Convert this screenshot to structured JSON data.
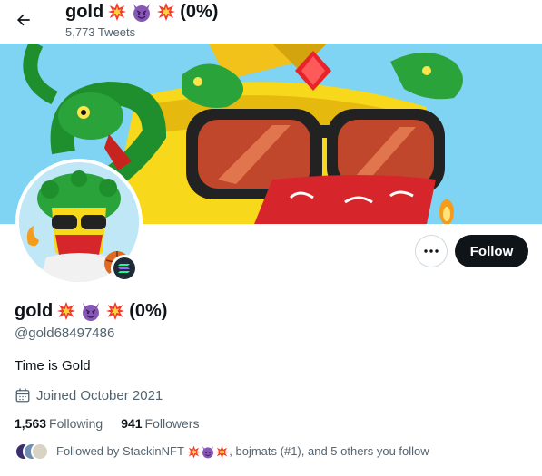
{
  "header": {
    "title_name": "gold",
    "title_suffix": "(0%)",
    "tweet_count": "5,773 Tweets"
  },
  "profile": {
    "name": "gold",
    "name_suffix": "(0%)",
    "handle": "@gold68497486",
    "bio": "Time is Gold",
    "joined": "Joined October 2021",
    "following_count": "1,563",
    "following_label": "Following",
    "followers_count": "941",
    "followers_label": "Followers"
  },
  "actions": {
    "follow_label": "Follow"
  },
  "followed_by": {
    "prefix": "Followed by StackinNFT",
    "suffix": ", bojmats (#1), and 5 others you follow"
  },
  "icons": [
    "back-arrow-icon",
    "collision-emoji-icon",
    "smiling-devil-emoji-icon",
    "more-dots-icon",
    "calendar-icon",
    "solana-badge-icon"
  ],
  "colors": {
    "text_primary": "#0f1419",
    "text_secondary": "#536471",
    "follow_bg": "#0f1419",
    "banner_sky": "#7fd3f3"
  }
}
